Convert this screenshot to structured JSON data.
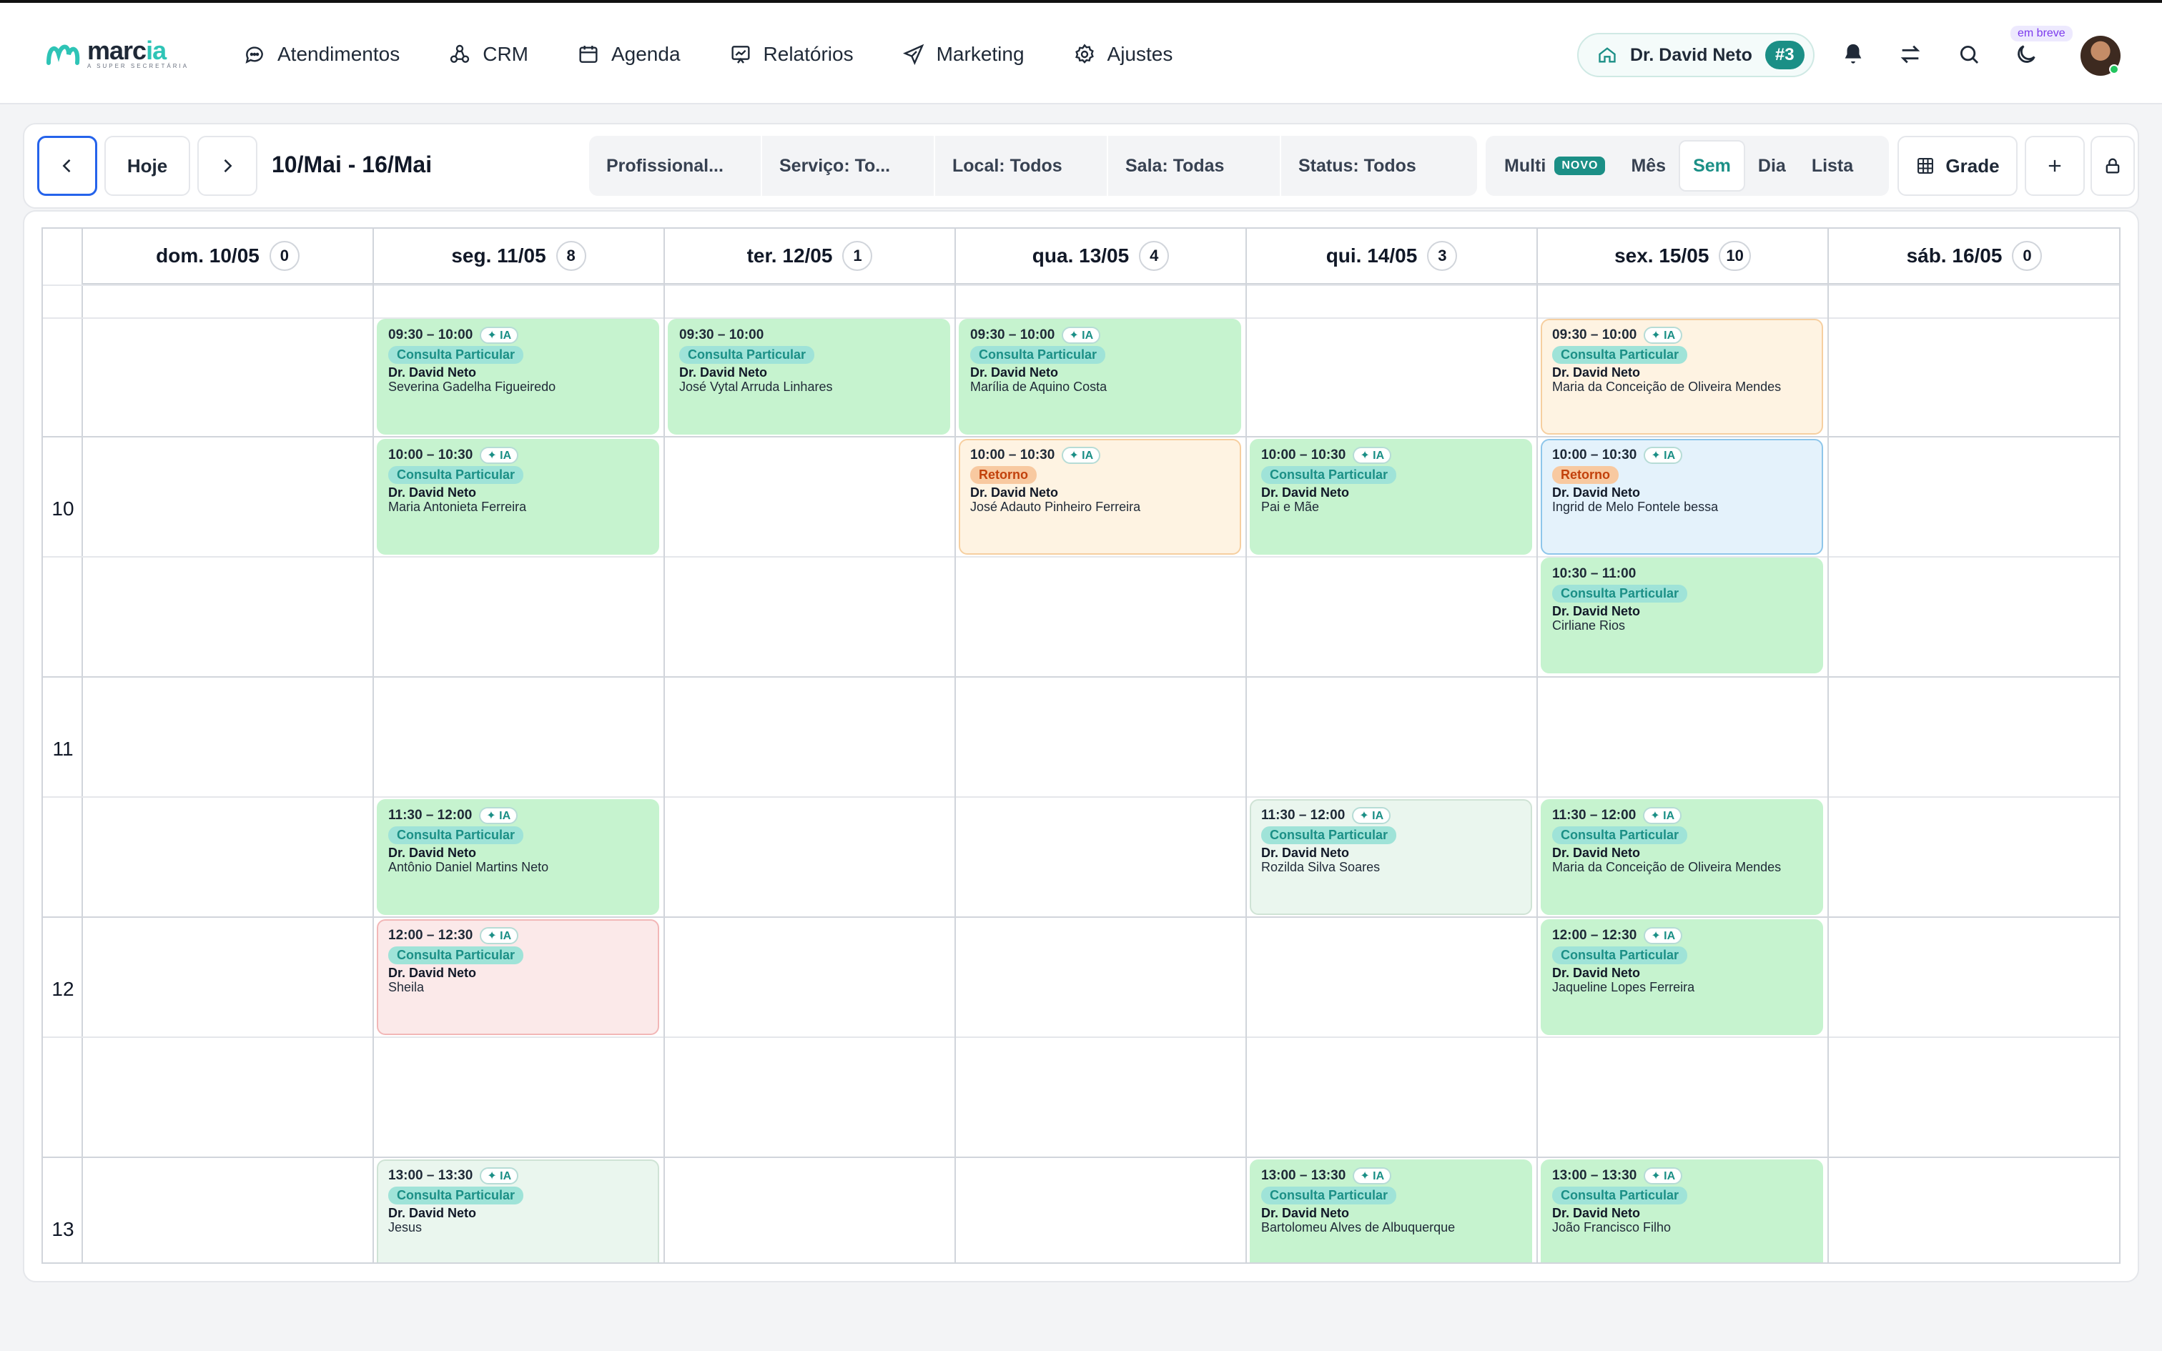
{
  "brand": {
    "name_main": "marc",
    "name_accent": "ia",
    "tagline": "A SUPER SECRETÁRIA"
  },
  "nav": [
    {
      "label": "Atendimentos",
      "icon": "chat-bubble-icon"
    },
    {
      "label": "CRM",
      "icon": "network-icon"
    },
    {
      "label": "Agenda",
      "icon": "calendar-icon"
    },
    {
      "label": "Relatórios",
      "icon": "chart-icon"
    },
    {
      "label": "Marketing",
      "icon": "send-icon"
    },
    {
      "label": "Ajustes",
      "icon": "gear-icon"
    }
  ],
  "user": {
    "name": "Dr. David Neto",
    "badge": "#3"
  },
  "coming_soon": "em breve",
  "toolbar": {
    "today": "Hoje",
    "range": "10/Mai - 16/Mai",
    "filters": [
      "Profissional...",
      "Serviço: To...",
      "Local: Todos",
      "Sala: Todas",
      "Status: Todos"
    ],
    "views": {
      "multi": "Multi",
      "novo": "NOVO",
      "month": "Mês",
      "week": "Sem",
      "day": "Dia",
      "list": "Lista"
    },
    "grid": "Grade"
  },
  "days": [
    {
      "label": "dom. 10/05",
      "count": "0"
    },
    {
      "label": "seg. 11/05",
      "count": "8"
    },
    {
      "label": "ter. 12/05",
      "count": "1"
    },
    {
      "label": "qua. 13/05",
      "count": "4"
    },
    {
      "label": "qui. 14/05",
      "count": "3"
    },
    {
      "label": "sex. 15/05",
      "count": "10"
    },
    {
      "label": "sáb. 16/05",
      "count": "0"
    }
  ],
  "hours": [
    "10",
    "11",
    "12",
    "13"
  ],
  "appointments": [
    {
      "time": "09:30 – 10:00",
      "ia": "✦ IA",
      "service": "Consulta Particular",
      "doctor": "Dr. David Neto",
      "patient": "Severina Gadelha Figueiredo"
    },
    {
      "time": "10:00 – 10:30",
      "ia": "✦ IA",
      "service": "Consulta Particular",
      "doctor": "Dr. David Neto",
      "patient": "Maria Antonieta Ferreira"
    },
    {
      "time": "11:30 – 12:00",
      "ia": "✦ IA",
      "service": "Consulta Particular",
      "doctor": "Dr. David Neto",
      "patient": "Antônio Daniel Martins Neto"
    },
    {
      "time": "12:00 – 12:30",
      "ia": "✦ IA",
      "service": "Consulta Particular",
      "doctor": "Dr. David Neto",
      "patient": "Sheila"
    },
    {
      "time": "13:00 – 13:30",
      "ia": "✦ IA",
      "service": "Consulta Particular",
      "doctor": "Dr. David Neto",
      "patient": "Jesus"
    },
    {
      "time": "09:30 – 10:00",
      "ia": "",
      "service": "Consulta Particular",
      "doctor": "Dr. David Neto",
      "patient": "José Vytal Arruda Linhares"
    },
    {
      "time": "09:30 – 10:00",
      "ia": "✦ IA",
      "service": "Consulta Particular",
      "doctor": "Dr. David Neto",
      "patient": "Marília de Aquino Costa"
    },
    {
      "time": "10:00 – 10:30",
      "ia": "✦ IA",
      "service": "Retorno",
      "doctor": "Dr. David Neto",
      "patient": "José Adauto Pinheiro Ferreira"
    },
    {
      "time": "10:00 – 10:30",
      "ia": "✦ IA",
      "service": "Consulta Particular",
      "doctor": "Dr. David Neto",
      "patient": "Pai e Mãe"
    },
    {
      "time": "11:30 – 12:00",
      "ia": "✦ IA",
      "service": "Consulta Particular",
      "doctor": "Dr. David Neto",
      "patient": "Rozilda Silva Soares"
    },
    {
      "time": "13:00 – 13:30",
      "ia": "✦ IA",
      "service": "Consulta Particular",
      "doctor": "Dr. David Neto",
      "patient": "Bartolomeu Alves de Albuquerque"
    },
    {
      "time": "09:30 – 10:00",
      "ia": "✦ IA",
      "service": "Consulta Particular",
      "doctor": "Dr. David Neto",
      "patient": "Maria da Conceição de Oliveira Mendes"
    },
    {
      "time": "10:00 – 10:30",
      "ia": "✦ IA",
      "service": "Retorno",
      "doctor": "Dr. David Neto",
      "patient": "Ingrid de Melo Fontele bessa"
    },
    {
      "time": "10:30 – 11:00",
      "ia": "",
      "service": "Consulta Particular",
      "doctor": "Dr. David Neto",
      "patient": "Cirliane Rios"
    },
    {
      "time": "11:30 – 12:00",
      "ia": "✦ IA",
      "service": "Consulta Particular",
      "doctor": "Dr. David Neto",
      "patient": "Maria da Conceição de Oliveira Mendes"
    },
    {
      "time": "12:00 – 12:30",
      "ia": "✦ IA",
      "service": "Consulta Particular",
      "doctor": "Dr. David Neto",
      "patient": "Jaqueline Lopes Ferreira"
    },
    {
      "time": "13:00 – 13:30",
      "ia": "✦ IA",
      "service": "Consulta Particular",
      "doctor": "Dr. David Neto",
      "patient": "João Francisco Filho"
    }
  ]
}
